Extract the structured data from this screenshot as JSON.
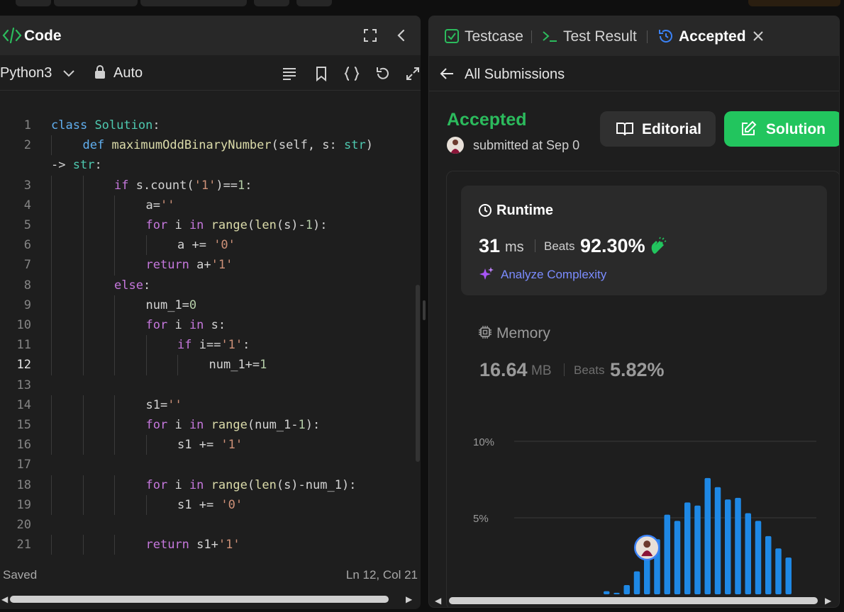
{
  "editor_panel": {
    "title": "Code",
    "language": "Python3",
    "mode": "Auto",
    "status_saved": "Saved",
    "cursor_position": "Ln 12, Col 21"
  },
  "code_lines": [
    {
      "n": "1",
      "indent": 0,
      "html": "<span class=\"kw2\">class</span> <span class=\"cls\">Solution</span>:"
    },
    {
      "n": "2",
      "indent": 1,
      "html": "<span class=\"kw2\">def</span> <span class=\"fn\">maximumOddBinaryNumber</span>(self, s: <span class=\"ty\">str</span>)"
    },
    {
      "n": "",
      "indent": 0,
      "html": "-> <span class=\"ty\">str</span>:"
    },
    {
      "n": "3",
      "indent": 2,
      "html": "<span class=\"kw\">if</span> s.count(<span class=\"str\">'1'</span>)==<span class=\"num\">1</span>:"
    },
    {
      "n": "4",
      "indent": 3,
      "html": "a=<span class=\"str\">''</span>"
    },
    {
      "n": "5",
      "indent": 3,
      "html": "<span class=\"kw\">for</span> i <span class=\"kw\">in</span> <span class=\"fn\">range</span>(<span class=\"fn\">len</span>(s)-<span class=\"num\">1</span>):"
    },
    {
      "n": "6",
      "indent": 4,
      "html": "a += <span class=\"str\">'0'</span>"
    },
    {
      "n": "7",
      "indent": 3,
      "html": "<span class=\"kw\">return</span> a+<span class=\"str\">'1'</span>"
    },
    {
      "n": "8",
      "indent": 2,
      "html": "<span class=\"kw\">else</span>:"
    },
    {
      "n": "9",
      "indent": 3,
      "html": "num_1=<span class=\"num\">0</span>"
    },
    {
      "n": "10",
      "indent": 3,
      "html": "<span class=\"kw\">for</span> i <span class=\"kw\">in</span> s:"
    },
    {
      "n": "11",
      "indent": 4,
      "html": "<span class=\"kw\">if</span> i==<span class=\"str\">'1'</span>:"
    },
    {
      "n": "12",
      "indent": 5,
      "html": "num_1+=<span class=\"num\">1</span>",
      "active": true
    },
    {
      "n": "13",
      "indent": 0,
      "html": ""
    },
    {
      "n": "14",
      "indent": 3,
      "html": "s1=<span class=\"str\">''</span>"
    },
    {
      "n": "15",
      "indent": 3,
      "html": "<span class=\"kw\">for</span> i <span class=\"kw\">in</span> <span class=\"fn\">range</span>(num_1-<span class=\"num\">1</span>):"
    },
    {
      "n": "16",
      "indent": 4,
      "html": "s1 += <span class=\"str\">'1'</span>"
    },
    {
      "n": "17",
      "indent": 0,
      "html": ""
    },
    {
      "n": "18",
      "indent": 3,
      "html": "<span class=\"kw\">for</span> i <span class=\"kw\">in</span> <span class=\"fn\">range</span>(<span class=\"fn\">len</span>(s)-num_1):"
    },
    {
      "n": "19",
      "indent": 4,
      "html": "s1 += <span class=\"str\">'0'</span>"
    },
    {
      "n": "20",
      "indent": 0,
      "html": ""
    },
    {
      "n": "21",
      "indent": 3,
      "html": "<span class=\"kw\">return</span> s1+<span class=\"str\">'1'</span>"
    }
  ],
  "result_panel": {
    "tabs": [
      {
        "label": "Testcase"
      },
      {
        "label": "Test Result"
      },
      {
        "label": "Accepted"
      }
    ],
    "back_label": "All Submissions",
    "status": "Accepted",
    "submitted_text": "submitted at Sep 0",
    "editorial_label": "Editorial",
    "solution_label": "Solution",
    "runtime": {
      "title": "Runtime",
      "value": "31",
      "unit": "ms",
      "beats_label": "Beats",
      "beats_pct": "92.30%",
      "analyze_label": "Analyze Complexity"
    },
    "memory": {
      "title": "Memory",
      "value": "16.64",
      "unit": "MB",
      "beats_label": "Beats",
      "beats_pct": "5.82%"
    }
  },
  "colors": {
    "accepted_green": "#2cbb5d",
    "solution_green": "#22c55e",
    "bar_blue": "#1e88e5",
    "analyze_blue": "#7b8cff"
  },
  "chart_data": {
    "type": "bar",
    "y_ticks": [
      "10%",
      "5%"
    ],
    "ylim": [
      0,
      10
    ],
    "values": [
      0.2,
      0.1,
      0.6,
      1.5,
      2.4,
      3.6,
      5.2,
      4.8,
      6.0,
      5.8,
      7.6,
      7.0,
      6.2,
      6.3,
      5.3,
      4.8,
      3.8,
      3.0,
      2.4
    ]
  }
}
